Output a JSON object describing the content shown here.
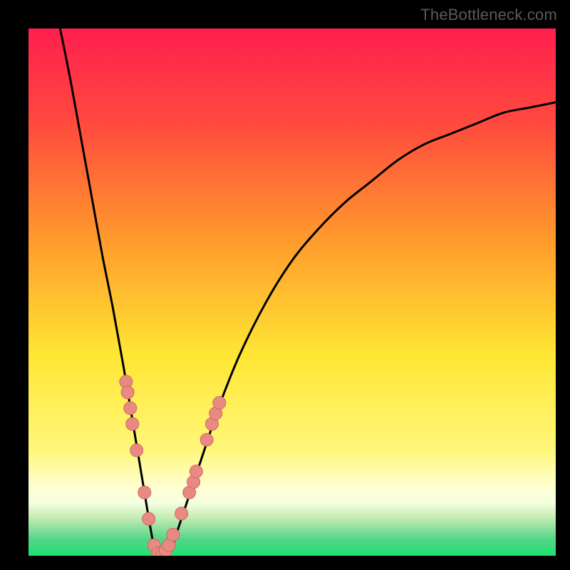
{
  "watermark": "TheBottleneck.com",
  "colors": {
    "frame": "#000000",
    "gradient_top": "#ff1f4e",
    "gradient_mid1": "#ff7a2a",
    "gradient_mid2": "#ffe634",
    "gradient_band_light": "#ffffd2",
    "gradient_bottom": "#1de273",
    "curve": "#000000",
    "marker_fill": "#e98a82",
    "marker_stroke": "#cc6a63"
  },
  "chart_data": {
    "type": "line",
    "title": "",
    "xlabel": "",
    "ylabel": "",
    "xlim": [
      0,
      100
    ],
    "ylim": [
      0,
      100
    ],
    "annotations": [
      "TheBottleneck.com"
    ],
    "series": [
      {
        "name": "bottleneck-curve",
        "x": [
          6,
          8,
          10,
          12,
          14,
          16,
          18,
          20,
          21,
          22,
          23,
          24,
          25,
          26,
          27,
          28,
          30,
          32,
          34,
          36,
          40,
          45,
          50,
          55,
          60,
          65,
          70,
          75,
          80,
          85,
          90,
          95,
          100
        ],
        "y": [
          100,
          90,
          79,
          68,
          57,
          47,
          36,
          24,
          18,
          12,
          6,
          1,
          0,
          0,
          1,
          4,
          10,
          16,
          22,
          28,
          38,
          48,
          56,
          62,
          67,
          71,
          75,
          78,
          80,
          82,
          84,
          85,
          86
        ]
      }
    ],
    "markers": [
      {
        "x": 18.5,
        "y": 33
      },
      {
        "x": 18.8,
        "y": 31
      },
      {
        "x": 19.3,
        "y": 28
      },
      {
        "x": 19.7,
        "y": 25
      },
      {
        "x": 20.5,
        "y": 20
      },
      {
        "x": 22.0,
        "y": 12
      },
      {
        "x": 22.8,
        "y": 7
      },
      {
        "x": 23.8,
        "y": 2
      },
      {
        "x": 24.6,
        "y": 0.5
      },
      {
        "x": 25.4,
        "y": 0.5
      },
      {
        "x": 26.0,
        "y": 1
      },
      {
        "x": 26.6,
        "y": 2
      },
      {
        "x": 27.4,
        "y": 4
      },
      {
        "x": 29.0,
        "y": 8
      },
      {
        "x": 30.5,
        "y": 12
      },
      {
        "x": 31.3,
        "y": 14
      },
      {
        "x": 31.8,
        "y": 16
      },
      {
        "x": 33.8,
        "y": 22
      },
      {
        "x": 34.8,
        "y": 25
      },
      {
        "x": 35.5,
        "y": 27
      },
      {
        "x": 36.2,
        "y": 29
      }
    ]
  }
}
